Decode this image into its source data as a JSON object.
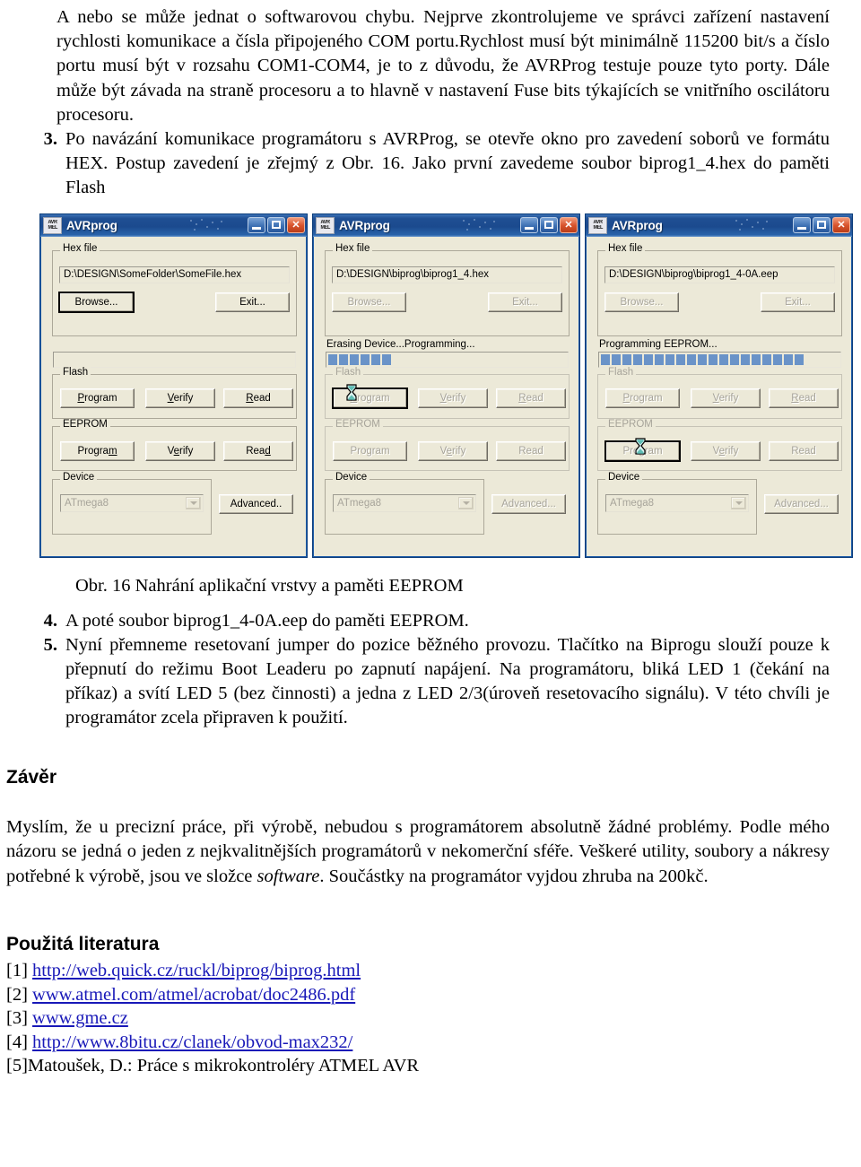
{
  "document": {
    "intro_paragraph": "A nebo se může jednat o softwarovou chybu. Nejprve zkontrolujeme ve správci zařízení nastavení rychlosti komunikace a čísla připojeného COM portu.Rychlost musí být minimálně 115200 bit/s a číslo portu musí být v rozsahu COM1-COM4, je to z důvodu, že AVRProg testuje pouze tyto porty. Dále může být závada na straně procesoru a to hlavně v nastavení Fuse bits týkajících se vnitřního oscilátoru procesoru.",
    "list_items": [
      {
        "number": "3.",
        "text": "Po navázání komunikace programátoru s AVRProg, se otevře okno pro zavedení soborů ve formátu HEX. Postup zavedení je zřejmý z Obr. 16. Jako první zavedeme soubor biprog1_4.hex do paměti Flash"
      },
      {
        "number": "4.",
        "text": "A poté soubor biprog1_4-0A.eep do paměti EEPROM."
      },
      {
        "number": "5.",
        "text": "Nyní přemneme resetovaní jumper do pozice běžného provozu. Tlačítko na Biprogu slouží pouze k přepnutí do režimu Boot Leaderu po zapnutí napájení. Na programátoru, bliká LED 1 (čekání na příkaz) a svítí LED 5 (bez činnosti) a jedna z LED 2/3(úroveň resetovacího signálu). V této chvíli je programátor zcela připraven k použití."
      }
    ],
    "figure_caption": "Obr. 16 Nahrání aplikační vrstvy a paměti EEPROM",
    "conclusion": {
      "heading": "Závěr",
      "text_before_italic": "Myslím, že u precizní práce, při výrobě, nebudou s programátorem absolutně žádné problémy. Podle mého názoru se jedná o jeden z nejkvalitnějších programátorů v nekomerční sféře. Veškeré utility, soubory a nákresy potřebné k výrobě, jsou ve složce ",
      "italic_word": "software",
      "text_after_italic": ". Součástky na programátor vyjdou zhruba na 200kč."
    },
    "bibliography": {
      "heading": "Použitá literatura",
      "entries": [
        {
          "marker": "[1]",
          "text": "http://web.quick.cz/ruckl/biprog/biprog.html",
          "is_link": true
        },
        {
          "marker": "[2]",
          "text": "www.atmel.com/atmel/acrobat/doc2486.pdf",
          "is_link": true
        },
        {
          "marker": "[3]",
          "text": "www.gme.cz",
          "is_link": true
        },
        {
          "marker": "[4]",
          "text": "http://www.8bitu.cz/clanek/obvod-max232/",
          "is_link": true
        },
        {
          "marker": "[5]",
          "text": "Matoušek, D.: Práce s mikrokontroléry ATMEL AVR",
          "is_link": false
        }
      ]
    }
  },
  "colors": {
    "titlebar_blue": "#1f4f93",
    "window_face": "#ece9d8",
    "progress_fill": "#6a93c8",
    "close_button_red": "#d8532c",
    "link_blue": "#1818b8"
  },
  "screenshots": [
    {
      "window_title": "AVRprog",
      "icon_line1": "AVR",
      "icon_line2": "MEL",
      "hex_group_label": "Hex file",
      "hex_path": "D:\\DESIGN\\SomeFolder\\SomeFile.hex",
      "browse_label": "Browse...",
      "exit_label": "Exit...",
      "status_text": "",
      "progress_chunks": 0,
      "flash_group_label": "Flash",
      "flash_buttons": [
        "Program",
        "Verify",
        "Read"
      ],
      "eeprom_group_label": "EEPROM",
      "eeprom_buttons": [
        "Program",
        "Verify",
        "Read"
      ],
      "device_group_label": "Device",
      "device_value": "ATmega8",
      "advanced_label": "Advanced..",
      "disabled_top": false,
      "flash_dim": false,
      "eeprom_dim": false,
      "focus": "browse",
      "hourglass_on": "none",
      "minimize_label": "Minimize",
      "maximize_label": "Maximize",
      "close_label": "Close"
    },
    {
      "window_title": "AVRprog",
      "icon_line1": "AVR",
      "icon_line2": "MEL",
      "hex_group_label": "Hex file",
      "hex_path": "D:\\DESIGN\\biprog\\biprog1_4.hex",
      "browse_label": "Browse...",
      "exit_label": "Exit...",
      "status_text": "Erasing Device...Programming...",
      "progress_chunks": 6,
      "flash_group_label": "Flash",
      "flash_buttons": [
        "Program",
        "Verify",
        "Read"
      ],
      "eeprom_group_label": "EEPROM",
      "eeprom_buttons": [
        "Program",
        "Verify",
        "Read"
      ],
      "device_group_label": "Device",
      "device_value": "ATmega8",
      "advanced_label": "Advanced...",
      "disabled_top": true,
      "flash_dim": true,
      "eeprom_dim": true,
      "focus": "flash-program",
      "hourglass_on": "flash-program",
      "minimize_label": "Minimize",
      "maximize_label": "Maximize",
      "close_label": "Close"
    },
    {
      "window_title": "AVRprog",
      "icon_line1": "AVR",
      "icon_line2": "MEL",
      "hex_group_label": "Hex file",
      "hex_path": "D:\\DESIGN\\biprog\\biprog1_4-0A.eep",
      "browse_label": "Browse...",
      "exit_label": "Exit...",
      "status_text": "Programming EEPROM...",
      "progress_chunks": 19,
      "flash_group_label": "Flash",
      "flash_buttons": [
        "Program",
        "Verify",
        "Read"
      ],
      "eeprom_group_label": "EEPROM",
      "eeprom_buttons": [
        "Program",
        "Verify",
        "Read"
      ],
      "device_group_label": "Device",
      "device_value": "ATmega8",
      "advanced_label": "Advanced...",
      "disabled_top": true,
      "flash_dim": true,
      "eeprom_dim": true,
      "focus": "eeprom-program",
      "hourglass_on": "eeprom-program",
      "minimize_label": "Minimize",
      "maximize_label": "Maximize",
      "close_label": "Close"
    }
  ]
}
